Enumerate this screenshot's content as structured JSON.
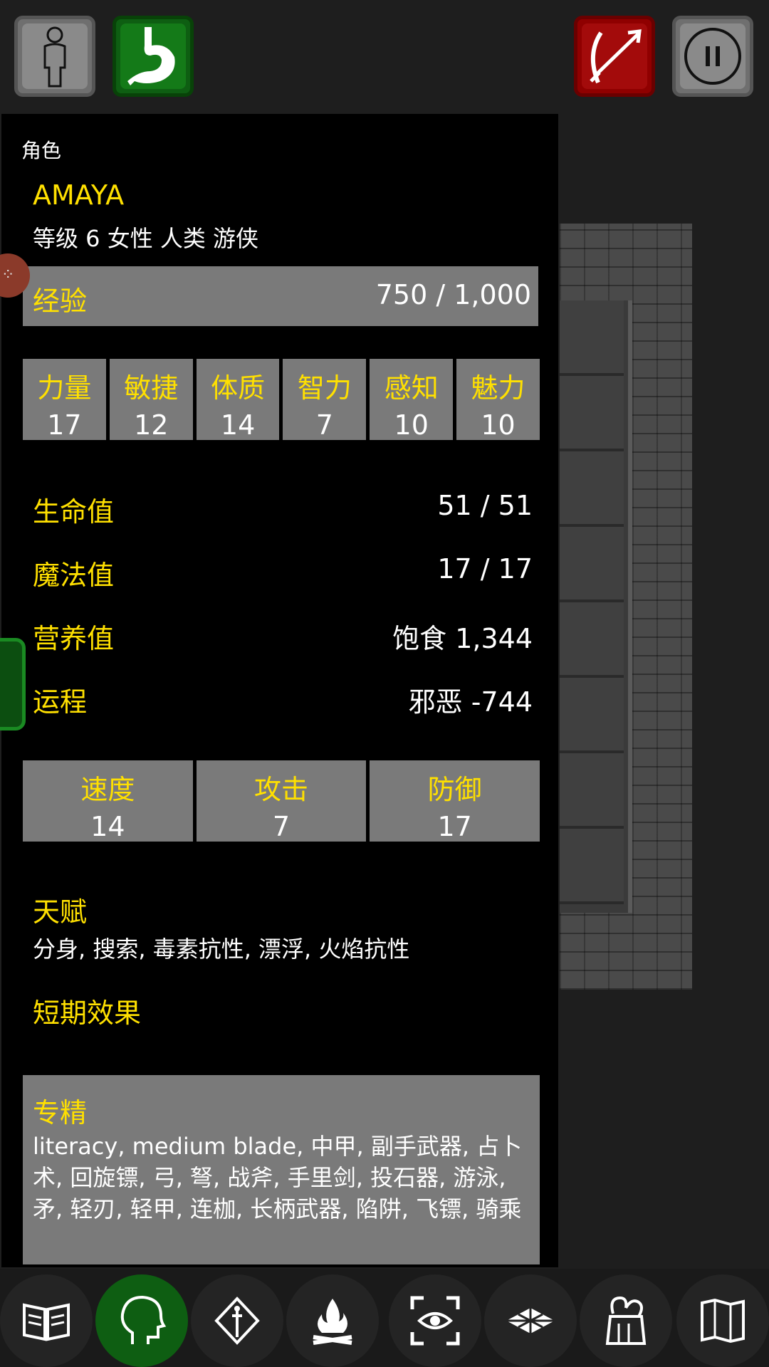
{
  "top_buttons": {
    "character": "character-icon",
    "hunger": "stomach-icon",
    "ranged": "bow-arrow-icon",
    "pause": "pause-icon"
  },
  "panel": {
    "title": "角色",
    "name": "AMAYA",
    "subtitle": "等级 6 女性 人类 游侠",
    "xp_label": "经验",
    "xp_value": "750 / 1,000",
    "attributes": [
      {
        "name": "力量",
        "value": "17"
      },
      {
        "name": "敏捷",
        "value": "12"
      },
      {
        "name": "体质",
        "value": "14"
      },
      {
        "name": "智力",
        "value": "7"
      },
      {
        "name": "感知",
        "value": "10"
      },
      {
        "name": "魅力",
        "value": "10"
      }
    ],
    "stats": [
      {
        "label": "生命值",
        "value": "51 / 51"
      },
      {
        "label": "魔法值",
        "value": "17 / 17"
      },
      {
        "label": "营养值",
        "value": "饱食 1,344"
      },
      {
        "label": "运程",
        "value": "邪恶 -744"
      }
    ],
    "combat": [
      {
        "name": "速度",
        "value": "14"
      },
      {
        "name": "攻击",
        "value": "7"
      },
      {
        "name": "防御",
        "value": "17"
      }
    ],
    "talents_heading": "天赋",
    "talents": "分身, 搜索, 毒素抗性, 漂浮, 火焰抗性",
    "effects_heading": "短期效果",
    "spec_heading": "专精",
    "spec_text": "literacy, medium blade, 中甲, 副手武器, 占卜术, 回旋镖, 弓, 弩, 战斧, 手里剑, 投石器, 游泳, 矛, 轻刃, 轻甲, 连枷, 长柄武器, 陷阱, 飞镖, 骑乘"
  },
  "toolbar": {
    "icons": [
      "book-icon",
      "head-icon",
      "spell-icon",
      "campfire-icon",
      "look-icon",
      "floor-icon",
      "bag-icon",
      "map-icon"
    ],
    "active": "head-icon"
  },
  "colors": {
    "accent": "#ffe000",
    "panel": "#000000",
    "cell": "#7a7a7a",
    "active_green": "#0e5e12",
    "red_button": "#8f0000"
  }
}
